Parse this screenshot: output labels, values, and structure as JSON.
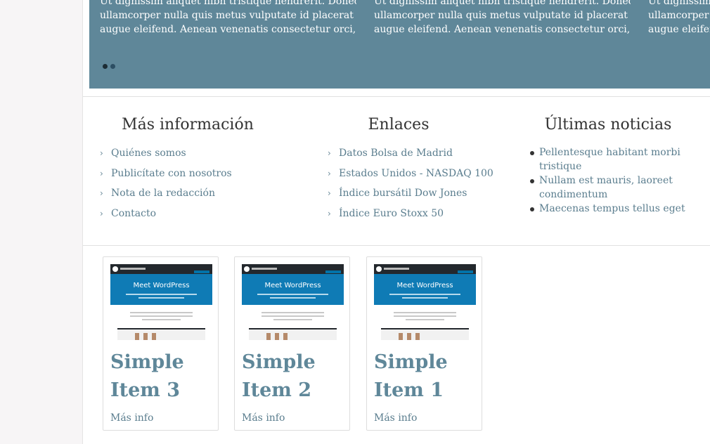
{
  "carousel": {
    "slides": [
      {
        "lines": [
          "Ut dignissim aliquet nibh tristique hendrerit. Donec",
          "ullamcorper nulla quis metus vulputate id placerat",
          "augue eleifend. Aenean venenatis consectetur orci,…"
        ]
      },
      {
        "lines": [
          "Ut dignissim aliquet nibh tristique hendrerit. Donec",
          "ullamcorper nulla quis metus vulputate id placerat",
          "augue eleifend. Aenean venenatis consectetur orci,…"
        ]
      },
      {
        "lines": [
          "Ut dignissim aliquet nibh tristique hendrerit. Donec",
          "ullamcorper nulla quis metus vulputate id placerat",
          "augue eleifend. Aenean venenatis consectetur orci,…"
        ]
      }
    ],
    "dots_active_index": 0,
    "colors": {
      "background": "#5f8799"
    }
  },
  "footer": {
    "info": {
      "title": "Más información",
      "links": [
        "Quiénes somos",
        "Publicítate con nosotros",
        "Nota de la redacción",
        "Contacto"
      ]
    },
    "enlaces": {
      "title": "Enlaces",
      "links": [
        "Datos Bolsa de Madrid",
        "Estados Unidos - NASDAQ 100",
        "Índice bursátil Dow Jones",
        "Índice Euro Stoxx 50"
      ]
    },
    "noticias": {
      "title": "Últimas noticias",
      "items": [
        "Pellentesque habitant morbi tristique",
        "Nullam est mauris, laoreet condimentum",
        "Maecenas tempus tellus eget"
      ]
    }
  },
  "cards": [
    {
      "title": "Simple Item 3",
      "thumb_title": "Meet WordPress",
      "more": "Más info"
    },
    {
      "title": "Simple Item 2",
      "thumb_title": "Meet WordPress",
      "more": "Más info"
    },
    {
      "title": "Simple Item 1",
      "thumb_title": "Meet WordPress",
      "more": "Más info"
    }
  ],
  "icons": {
    "link_marker": "chevron-right-icon",
    "news_marker": "bullet-icon"
  },
  "colors": {
    "link": "#5a7d8e",
    "card_title": "#5f8799",
    "heading": "#333333"
  }
}
